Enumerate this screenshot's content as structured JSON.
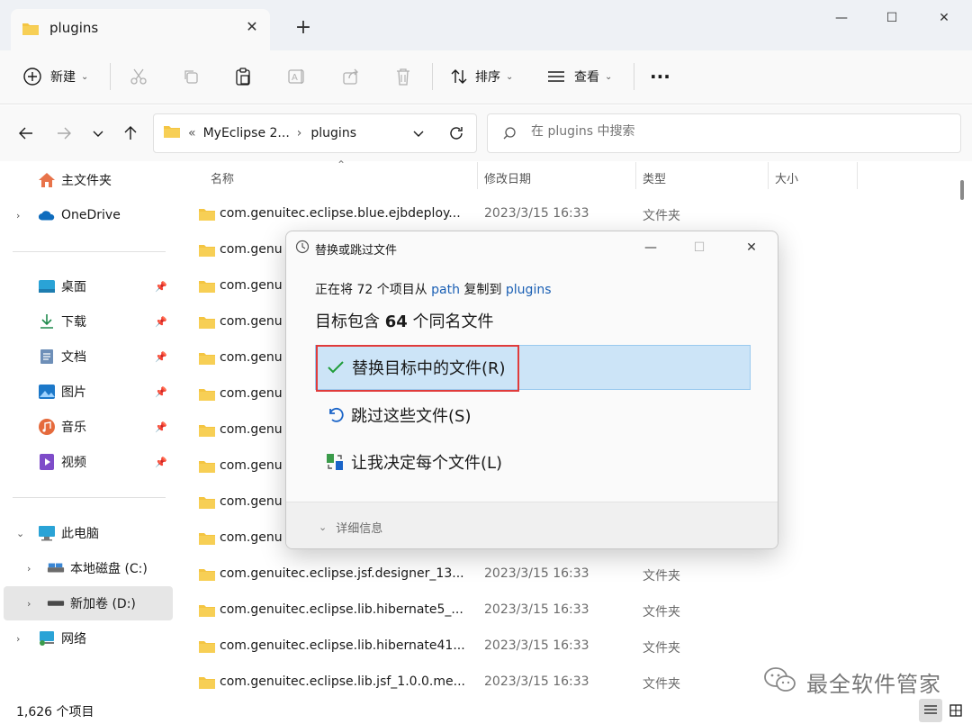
{
  "window": {
    "tab_title": "plugins",
    "tab_close": "✕",
    "new_tab": "+",
    "minimize": "—",
    "maximize": "☐",
    "close": "✕"
  },
  "toolbar": {
    "new_label": "新建",
    "sort_label": "排序",
    "view_label": "查看",
    "more": "···"
  },
  "address": {
    "overflow": "«",
    "segments": [
      "MyEclipse 2...",
      "plugins"
    ],
    "separator": "›",
    "search_placeholder": "在 plugins 中搜索"
  },
  "sidebar": {
    "items": [
      {
        "label": "主文件夹",
        "icon": "home-icon"
      },
      {
        "label": "OneDrive",
        "icon": "cloud-icon"
      },
      {
        "label": "桌面",
        "icon": "desktop-icon"
      },
      {
        "label": "下载",
        "icon": "download-icon"
      },
      {
        "label": "文档",
        "icon": "document-icon"
      },
      {
        "label": "图片",
        "icon": "picture-icon"
      },
      {
        "label": "音乐",
        "icon": "music-icon"
      },
      {
        "label": "视频",
        "icon": "video-icon"
      },
      {
        "label": "此电脑",
        "icon": "computer-icon"
      },
      {
        "label": "本地磁盘 (C:)",
        "icon": "drive-icon"
      },
      {
        "label": "新加卷 (D:)",
        "icon": "drive-icon"
      },
      {
        "label": "网络",
        "icon": "network-icon"
      }
    ]
  },
  "filelist": {
    "columns": [
      "名称",
      "修改日期",
      "类型",
      "大小"
    ],
    "rows": [
      {
        "name": "com.genuitec.eclipse.blue.ejbdeploy...",
        "date": "2023/3/15 16:33",
        "type": "文件夹"
      },
      {
        "name": "com.genu",
        "date": "",
        "type": ""
      },
      {
        "name": "com.genu",
        "date": "",
        "type": ""
      },
      {
        "name": "com.genu",
        "date": "",
        "type": ""
      },
      {
        "name": "com.genu",
        "date": "",
        "type": ""
      },
      {
        "name": "com.genu",
        "date": "",
        "type": ""
      },
      {
        "name": "com.genu",
        "date": "",
        "type": ""
      },
      {
        "name": "com.genu",
        "date": "",
        "type": ""
      },
      {
        "name": "com.genu",
        "date": "",
        "type": ""
      },
      {
        "name": "com.genu",
        "date": "",
        "type": ""
      },
      {
        "name": "com.genuitec.eclipse.jsf.designer_13...",
        "date": "2023/3/15 16:33",
        "type": "文件夹"
      },
      {
        "name": "com.genuitec.eclipse.lib.hibernate5_...",
        "date": "2023/3/15 16:33",
        "type": "文件夹"
      },
      {
        "name": "com.genuitec.eclipse.lib.hibernate41...",
        "date": "2023/3/15 16:33",
        "type": "文件夹"
      },
      {
        "name": "com.genuitec.eclipse.lib.jsf_1.0.0.me...",
        "date": "2023/3/15 16:33",
        "type": "文件夹"
      }
    ]
  },
  "status": {
    "count": "1,626 个项目"
  },
  "watermark": {
    "text": "最全软件管家"
  },
  "dialog": {
    "title": "替换或跳过文件",
    "line1_prefix": "正在将 72 个项目从 ",
    "line1_src": "path",
    "line1_mid": " 复制到 ",
    "line1_dst": "plugins",
    "line2_prefix": "目标包含 ",
    "line2_count": "64",
    "line2_suffix": " 个同名文件",
    "option_replace": "替换目标中的文件(R)",
    "option_skip": "跳过这些文件(S)",
    "option_decide": "让我决定每个文件(L)",
    "more_info": "详细信息"
  },
  "colors": {
    "accent": "#0067c0",
    "selection": "#cce4f7",
    "highlight": "#e03b3b",
    "folder": "#f4c542"
  }
}
